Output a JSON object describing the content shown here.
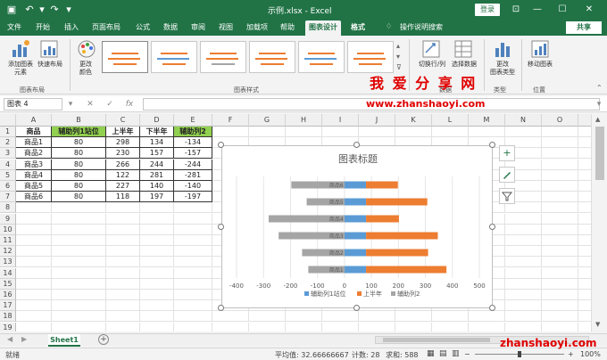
{
  "window": {
    "title": "示例.xlsx  -  Excel",
    "login": "登录"
  },
  "menu": {
    "tabs": [
      "文件",
      "开始",
      "插入",
      "页面布局",
      "公式",
      "数据",
      "审阅",
      "视图",
      "加载项",
      "帮助",
      "图表设计",
      "格式"
    ],
    "active": "图表设计",
    "tell_me": "操作说明搜索",
    "share": "共享"
  },
  "ribbon": {
    "add_element": "添加图表\n元素",
    "quick_layout": "快速布局",
    "change_colors": "更改\n颜色",
    "group_layouts": "图表布局",
    "group_styles": "图表样式",
    "switch_row_col": "切换行/列",
    "select_data": "选择数据",
    "group_data": "数据",
    "change_type": "更改\n图表类型",
    "group_type": "类型",
    "move_chart": "移动图表",
    "group_location": "位置"
  },
  "formula_bar": {
    "name_box": "图表 4",
    "fx": "fx",
    "value": ""
  },
  "grid": {
    "columns": [
      "A",
      "B",
      "C",
      "D",
      "E",
      "F",
      "G",
      "H",
      "I",
      "J",
      "K",
      "L",
      "M",
      "N",
      "O",
      "P"
    ],
    "rows": [
      "1",
      "2",
      "3",
      "4",
      "5",
      "6",
      "7",
      "8",
      "9",
      "10",
      "11",
      "12",
      "13",
      "14",
      "15",
      "16",
      "17",
      "18",
      "19"
    ],
    "headers": [
      "商品",
      "辅助列1站位",
      "上半年",
      "下半年",
      "辅助列2"
    ],
    "data": [
      [
        "商品1",
        "80",
        "298",
        "134",
        "-134"
      ],
      [
        "商品2",
        "80",
        "230",
        "157",
        "-157"
      ],
      [
        "商品3",
        "80",
        "266",
        "244",
        "-244"
      ],
      [
        "商品4",
        "80",
        "122",
        "281",
        "-281"
      ],
      [
        "商品5",
        "80",
        "227",
        "140",
        "-140"
      ],
      [
        "商品6",
        "80",
        "118",
        "197",
        "-197"
      ]
    ]
  },
  "chart_data": {
    "type": "bar",
    "title": "图表标题",
    "categories": [
      "商品1",
      "商品2",
      "商品3",
      "商品4",
      "商品5",
      "商品6"
    ],
    "series": [
      {
        "name": "辅助列1站位",
        "values": [
          80,
          80,
          80,
          80,
          80,
          80
        ],
        "color": "#5b9bd5"
      },
      {
        "name": "上半年",
        "values": [
          298,
          230,
          266,
          122,
          227,
          118
        ],
        "color": "#ed7d31"
      },
      {
        "name": "辅助列2",
        "values": [
          -134,
          -157,
          -244,
          -281,
          -140,
          -197
        ],
        "color": "#a5a5a5"
      }
    ],
    "xlim": [
      -400,
      500
    ],
    "xticks": [
      "-400",
      "-300",
      "-200",
      "-100",
      "0",
      "100",
      "200",
      "300",
      "400",
      "500"
    ],
    "category_order": "商品1 at bottom, 商品6 at top",
    "legend": "bottom",
    "grid": true
  },
  "side_buttons": [
    "+",
    "brush",
    "filter"
  ],
  "sheet": {
    "tab": "Sheet1",
    "add": "+"
  },
  "status": {
    "mode": "就绪",
    "average": "平均值: 32.66666667",
    "count": "计数: 28",
    "sum": "求和: 588",
    "zoom": "100%"
  },
  "watermark": {
    "cn": "我 爱 分 享 网",
    "url": "www.zhanshaoyi.com",
    "url2": "zhanshaoyi.com"
  }
}
